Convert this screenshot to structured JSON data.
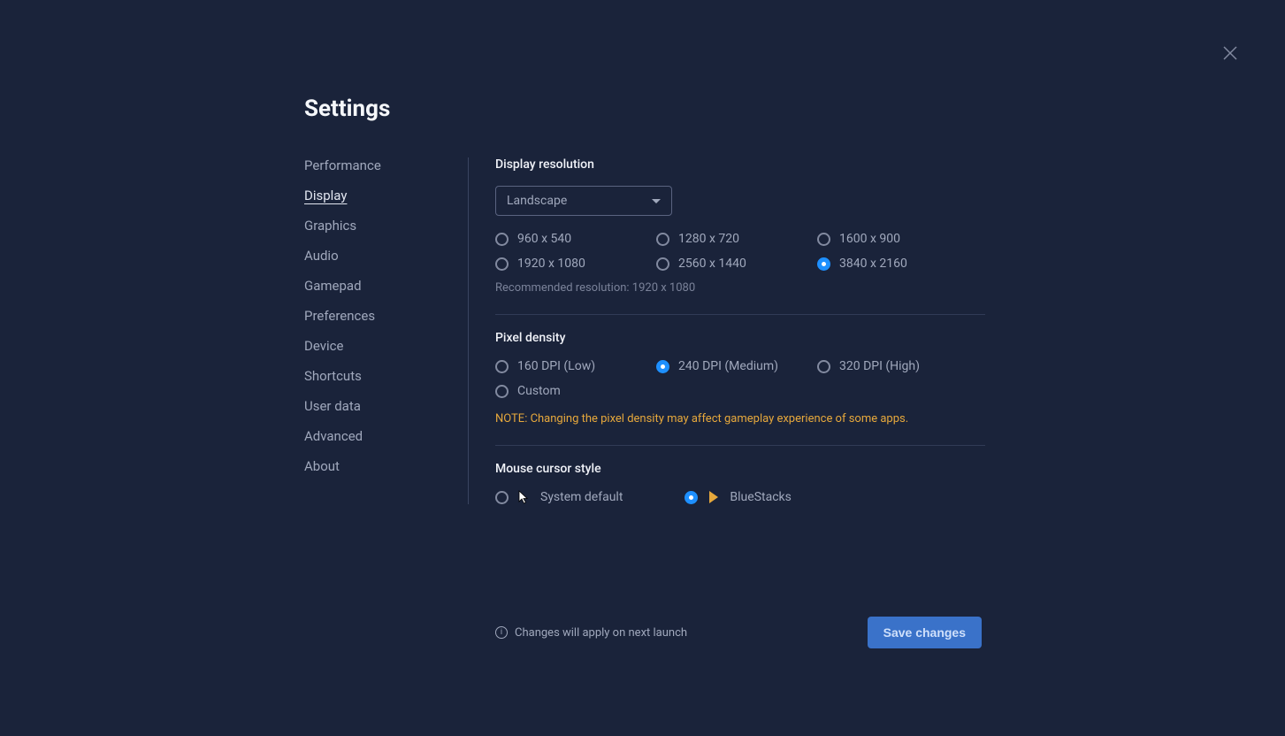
{
  "title": "Settings",
  "sidebar": {
    "items": [
      {
        "label": "Performance"
      },
      {
        "label": "Display"
      },
      {
        "label": "Graphics"
      },
      {
        "label": "Audio"
      },
      {
        "label": "Gamepad"
      },
      {
        "label": "Preferences"
      },
      {
        "label": "Device"
      },
      {
        "label": "Shortcuts"
      },
      {
        "label": "User data"
      },
      {
        "label": "Advanced"
      },
      {
        "label": "About"
      }
    ],
    "active_index": 1
  },
  "display_resolution": {
    "heading": "Display resolution",
    "orientation_selected": "Landscape",
    "options": [
      "960 x 540",
      "1280 x 720",
      "1600 x 900",
      "1920 x 1080",
      "2560 x 1440",
      "3840 x 2160"
    ],
    "selected_index": 5,
    "recommended_text": "Recommended resolution: 1920 x 1080"
  },
  "pixel_density": {
    "heading": "Pixel density",
    "options": [
      "160 DPI (Low)",
      "240 DPI (Medium)",
      "320 DPI (High)",
      "Custom"
    ],
    "selected_index": 1,
    "note": "NOTE: Changing the pixel density may affect gameplay experience of some apps."
  },
  "cursor_style": {
    "heading": "Mouse cursor style",
    "options": [
      {
        "label": "System default"
      },
      {
        "label": "BlueStacks"
      }
    ],
    "selected_index": 1
  },
  "footer": {
    "info": "Changes will apply on next launch",
    "save_label": "Save changes"
  }
}
